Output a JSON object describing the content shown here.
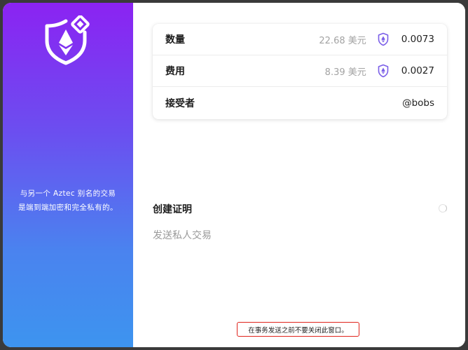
{
  "sidebar": {
    "logo_icon": "aztec-shield-ethereum-icon",
    "description_line1": "与另一个 Aztec 别名的交易",
    "description_line2": "是端到端加密和完全私有的。"
  },
  "summary": {
    "rows": [
      {
        "label": "数量",
        "fiat": "22.68 美元",
        "icon": "private-eth-shield-icon",
        "value": "0.0073"
      },
      {
        "label": "费用",
        "fiat": "8.39 美元",
        "icon": "private-eth-shield-icon",
        "value": "0.0027"
      },
      {
        "label": "接受者",
        "value": "@bobs"
      }
    ]
  },
  "progress": {
    "step_title": "创建证明",
    "step_subtitle": "发送私人交易"
  },
  "footer": {
    "warning": "在事务发送之前不要关闭此窗口。"
  },
  "colors": {
    "sidebar_top": "#8b23f2",
    "sidebar_bottom": "#3d94ef",
    "warning_border": "#e0241c"
  }
}
